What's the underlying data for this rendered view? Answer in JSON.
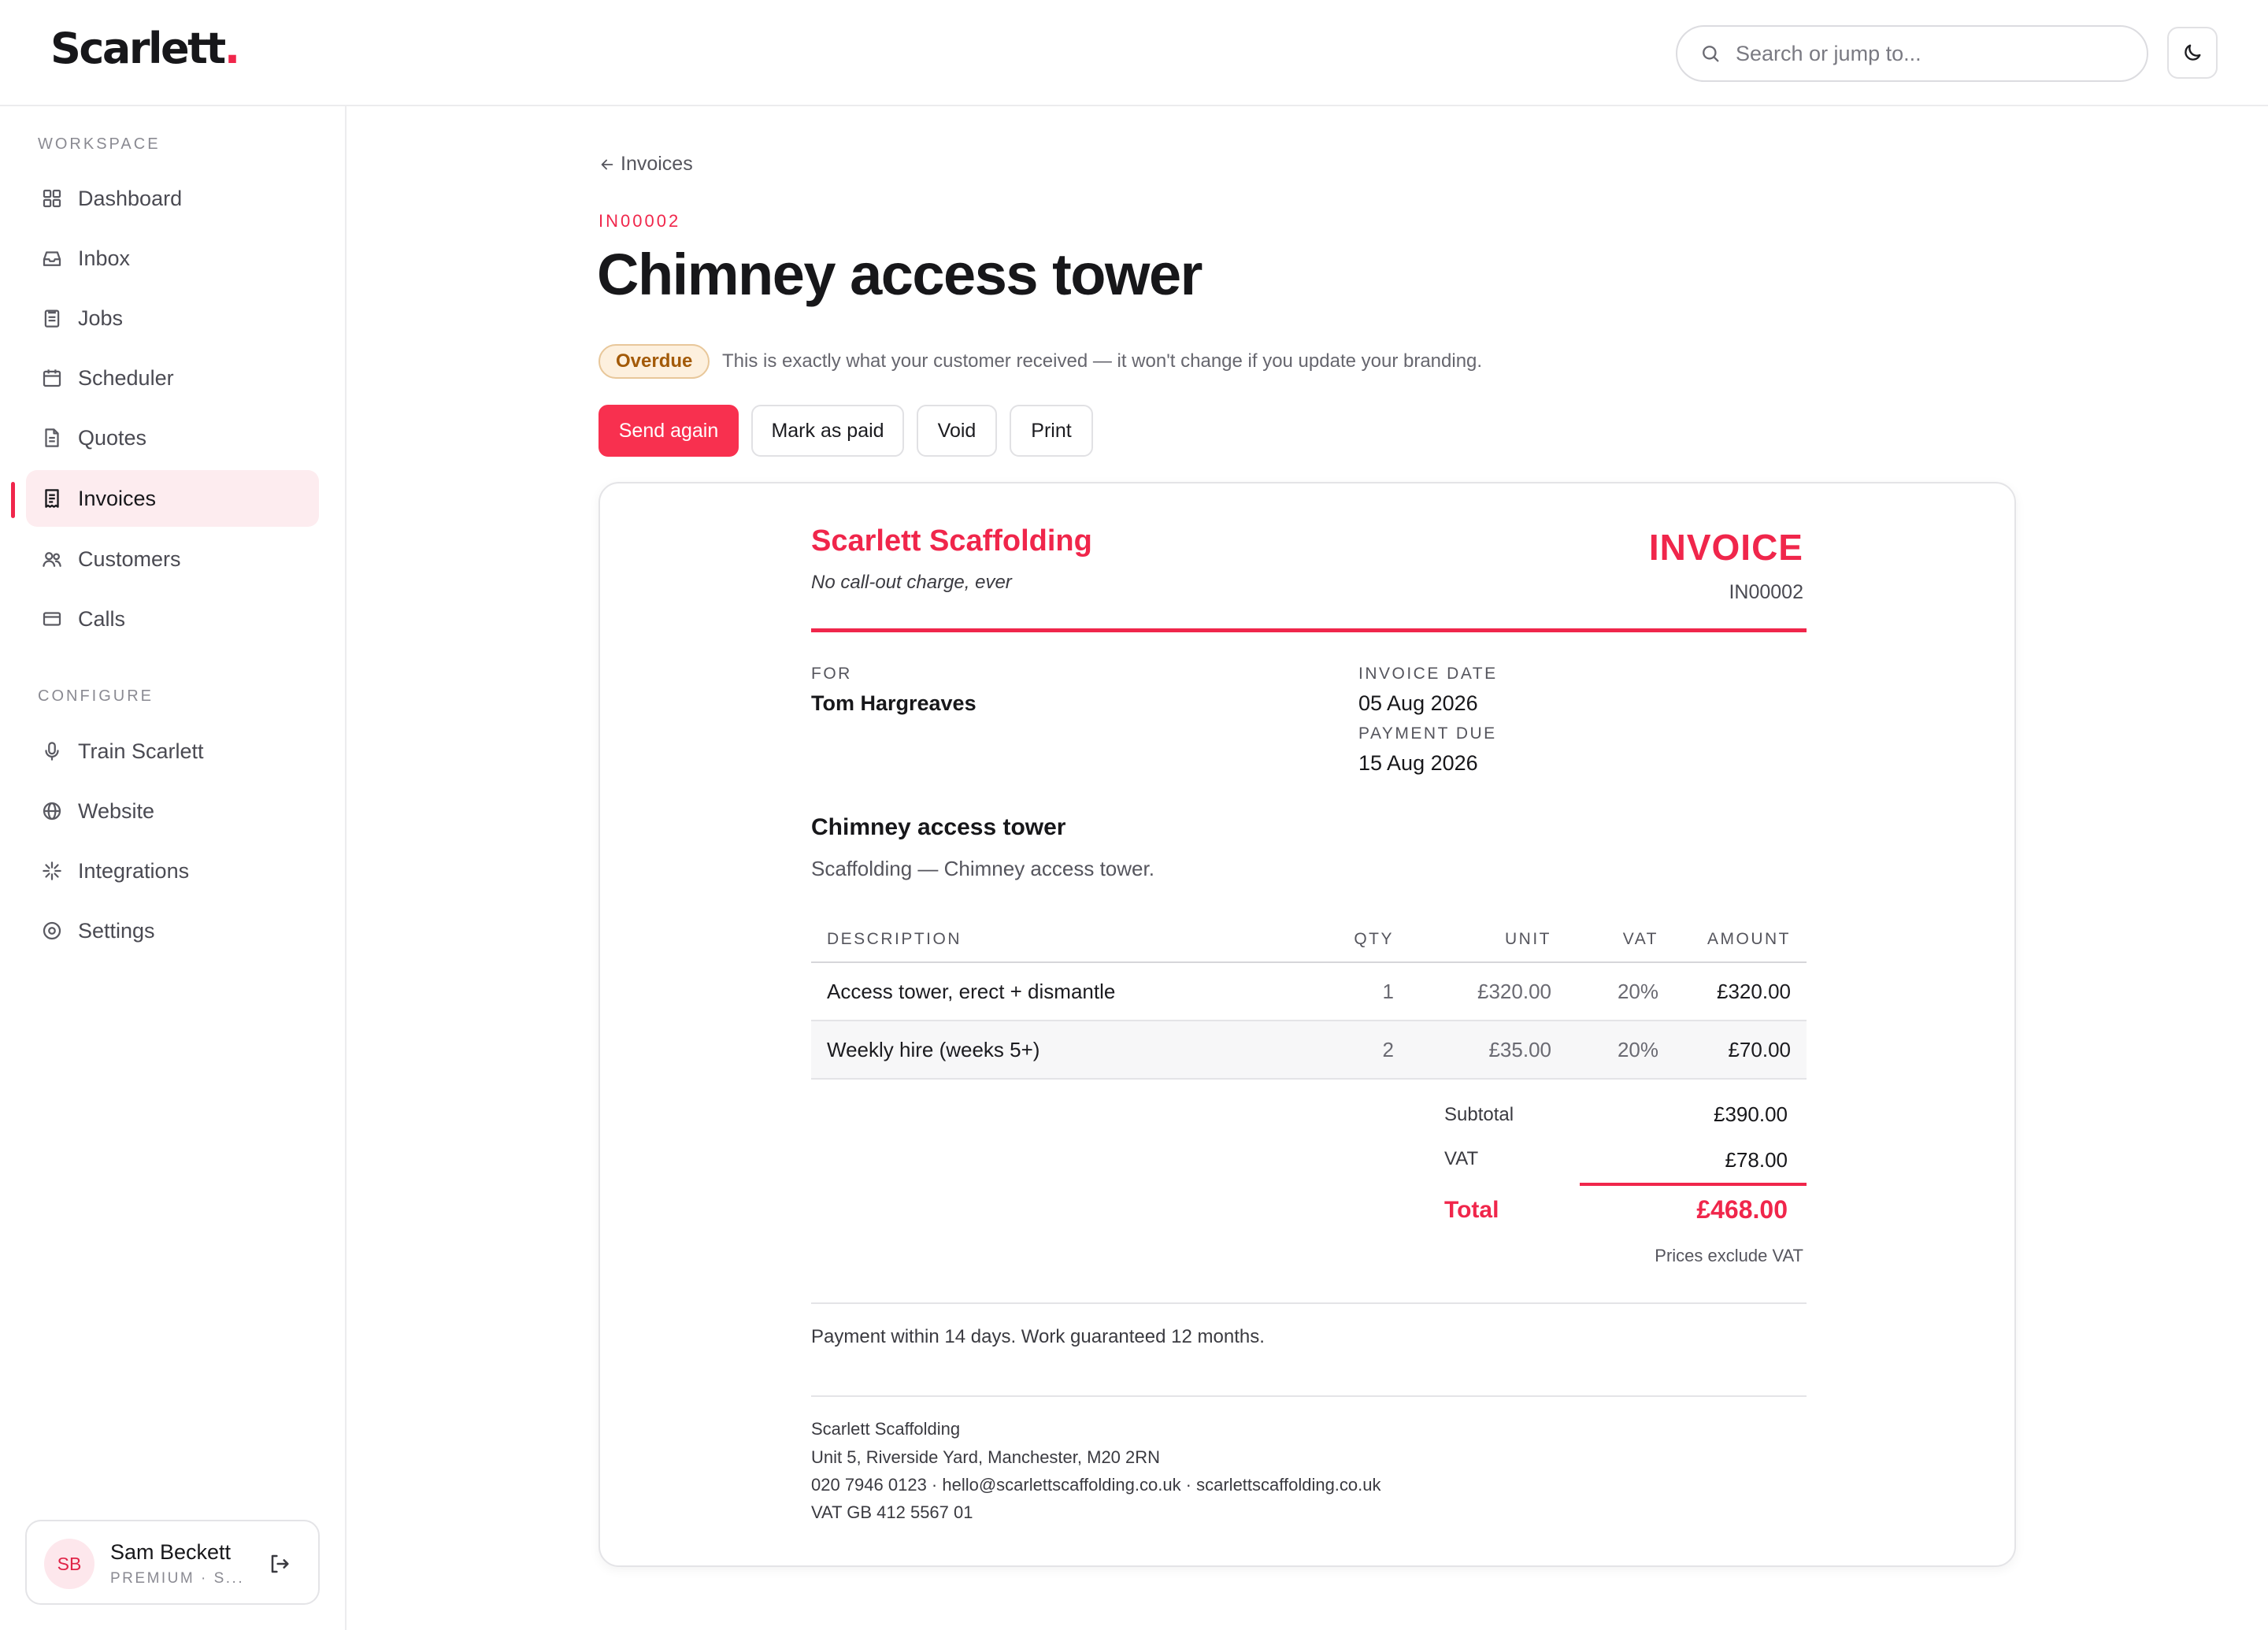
{
  "app": {
    "logo_text": "Scarlett",
    "logo_dot": "."
  },
  "search": {
    "placeholder": "Search or jump to..."
  },
  "sidebar": {
    "workspace_label": "WORKSPACE",
    "workspace_items": [
      {
        "label": "Dashboard",
        "icon": "grid-icon"
      },
      {
        "label": "Inbox",
        "icon": "inbox-icon"
      },
      {
        "label": "Jobs",
        "icon": "clipboard-icon"
      },
      {
        "label": "Scheduler",
        "icon": "calendar-icon"
      },
      {
        "label": "Quotes",
        "icon": "document-icon"
      },
      {
        "label": "Invoices",
        "icon": "receipt-icon",
        "active": true
      },
      {
        "label": "Customers",
        "icon": "users-icon"
      },
      {
        "label": "Calls",
        "icon": "phone-card-icon"
      }
    ],
    "configure_label": "CONFIGURE",
    "configure_items": [
      {
        "label": "Train Scarlett",
        "icon": "microphone-icon"
      },
      {
        "label": "Website",
        "icon": "globe-icon"
      },
      {
        "label": "Integrations",
        "icon": "sparkle-icon"
      },
      {
        "label": "Settings",
        "icon": "settings-icon"
      }
    ],
    "user": {
      "initials": "SB",
      "name": "Sam Beckett",
      "plan": "PREMIUM · S..."
    }
  },
  "header": {
    "back_label": "Invoices",
    "doc_ref": "IN00002",
    "title": "Chimney access tower",
    "status": "Overdue",
    "status_note": "This is exactly what your customer received — it won't change if you update your branding."
  },
  "actions": {
    "send_again": "Send again",
    "mark_paid": "Mark as paid",
    "void": "Void",
    "print": "Print"
  },
  "invoice": {
    "company_name": "Scarlett Scaffolding",
    "tagline": "No call-out charge, ever",
    "heading": "INVOICE",
    "number": "IN00002",
    "for_label": "FOR",
    "customer": "Tom Hargreaves",
    "invoice_date_label": "INVOICE DATE",
    "invoice_date": "05 Aug 2026",
    "payment_due_label": "PAYMENT DUE",
    "payment_due": "15 Aug 2026",
    "job_title": "Chimney access tower",
    "job_description": "Scaffolding — Chimney access tower.",
    "columns": {
      "description": "DESCRIPTION",
      "qty": "QTY",
      "unit": "UNIT",
      "vat": "VAT",
      "amount": "AMOUNT"
    },
    "line_items": [
      {
        "description": "Access tower, erect + dismantle",
        "qty": "1",
        "unit": "£320.00",
        "vat": "20%",
        "amount": "£320.00"
      },
      {
        "description": "Weekly hire (weeks 5+)",
        "qty": "2",
        "unit": "£35.00",
        "vat": "20%",
        "amount": "£70.00"
      }
    ],
    "subtotal_label": "Subtotal",
    "subtotal": "£390.00",
    "vat_label": "VAT",
    "vat": "£78.00",
    "total_label": "Total",
    "total": "£468.00",
    "price_note": "Prices exclude VAT",
    "terms": "Payment within 14 days. Work guaranteed 12 months.",
    "footer": {
      "company": "Scarlett Scaffolding",
      "address": "Unit 5, Riverside Yard, Manchester, M20 2RN",
      "contact": "020 7946 0123 · hello@scarlettscaffolding.co.uk · scarlettscaffolding.co.uk",
      "vat_number": "VAT GB 412 5567 01"
    }
  },
  "colors": {
    "accent": "#f0264b",
    "overdue_bg": "#fdf0de",
    "overdue_text": "#a35a08",
    "active_nav_bg": "#fdecef"
  }
}
